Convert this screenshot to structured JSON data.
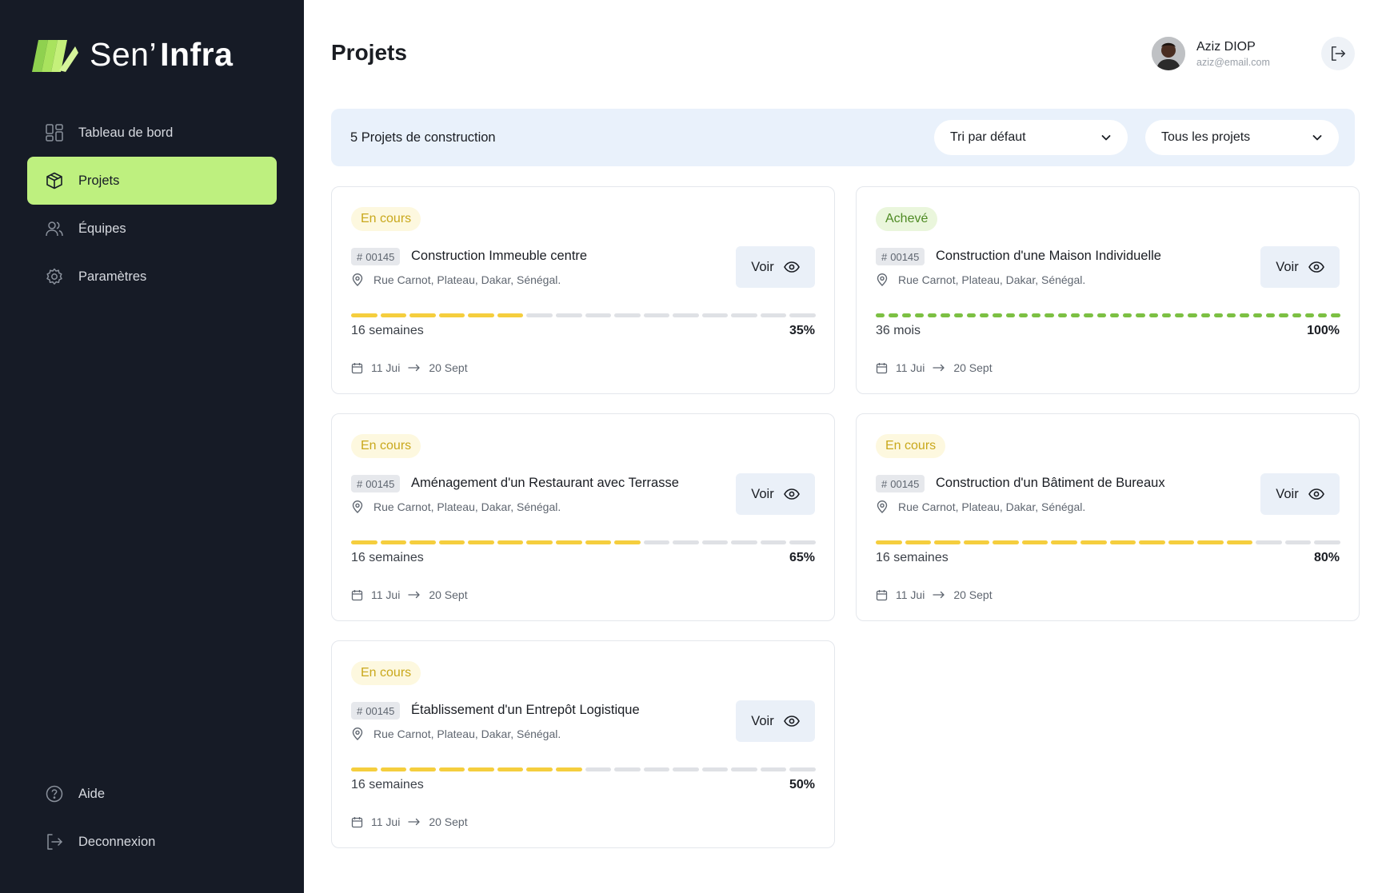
{
  "app": {
    "logo_part1": "Sen’",
    "logo_part2": "Infra",
    "colors": {
      "sidebar_bg": "#161b26",
      "accent": "#bef07f",
      "progress_yellow": "#f5ce3e",
      "progress_green": "#7cc043",
      "track": "#dfe1e5"
    }
  },
  "sidebar": {
    "items": [
      {
        "label": "Tableau de bord",
        "icon": "grid-icon",
        "active": false
      },
      {
        "label": "Projets",
        "icon": "box-icon",
        "active": true
      },
      {
        "label": "Équipes",
        "icon": "users-icon",
        "active": false
      },
      {
        "label": "Paramètres",
        "icon": "gear-icon",
        "active": false
      }
    ],
    "bottom": [
      {
        "label": "Aide",
        "icon": "help-icon"
      },
      {
        "label": "Deconnexion",
        "icon": "logout-icon"
      }
    ]
  },
  "header": {
    "title": "Projets",
    "user_name": "Aziz DIOP",
    "user_email": "aziz@email.com"
  },
  "filters": {
    "count_label": "5 Projets de construction",
    "sort_value": "Tri par défaut",
    "scope_value": "Tous les projets"
  },
  "voir_label": "Voir",
  "projects": [
    {
      "status": "En cours",
      "status_type": "progress",
      "id": "00145",
      "title": "Construction Immeuble centre",
      "address": "Rue Carnot, Plateau, Dakar, Sénégal.",
      "duration": "16 semaines",
      "percent_label": "35%",
      "progress": 0.35,
      "segments": 16,
      "start": "11 Jui",
      "end": "20 Sept"
    },
    {
      "status": "Achevé",
      "status_type": "done",
      "id": "00145",
      "title": "Construction d'une Maison Individuelle",
      "address": "Rue Carnot, Plateau, Dakar, Sénégal.",
      "duration": "36 mois",
      "percent_label": "100%",
      "progress": 1.0,
      "segments": 36,
      "start": "11 Jui",
      "end": "20 Sept"
    },
    {
      "status": "En cours",
      "status_type": "progress",
      "id": "00145",
      "title": "Aménagement d'un Restaurant avec Terrasse",
      "address": "Rue Carnot, Plateau, Dakar, Sénégal.",
      "duration": "16 semaines",
      "percent_label": "65%",
      "progress": 0.65,
      "segments": 16,
      "start": "11 Jui",
      "end": "20 Sept"
    },
    {
      "status": "En cours",
      "status_type": "progress",
      "id": "00145",
      "title": "Construction d'un Bâtiment de Bureaux",
      "address": "Rue Carnot, Plateau, Dakar, Sénégal.",
      "duration": "16 semaines",
      "percent_label": "80%",
      "progress": 0.8,
      "segments": 16,
      "start": "11 Jui",
      "end": "20 Sept"
    },
    {
      "status": "En cours",
      "status_type": "progress",
      "id": "00145",
      "title": "Établissement d'un Entrepôt Logistique",
      "address": "Rue Carnot, Plateau, Dakar, Sénégal.",
      "duration": "16 semaines",
      "percent_label": "50%",
      "progress": 0.5,
      "segments": 16,
      "start": "11 Jui",
      "end": "20 Sept"
    }
  ]
}
